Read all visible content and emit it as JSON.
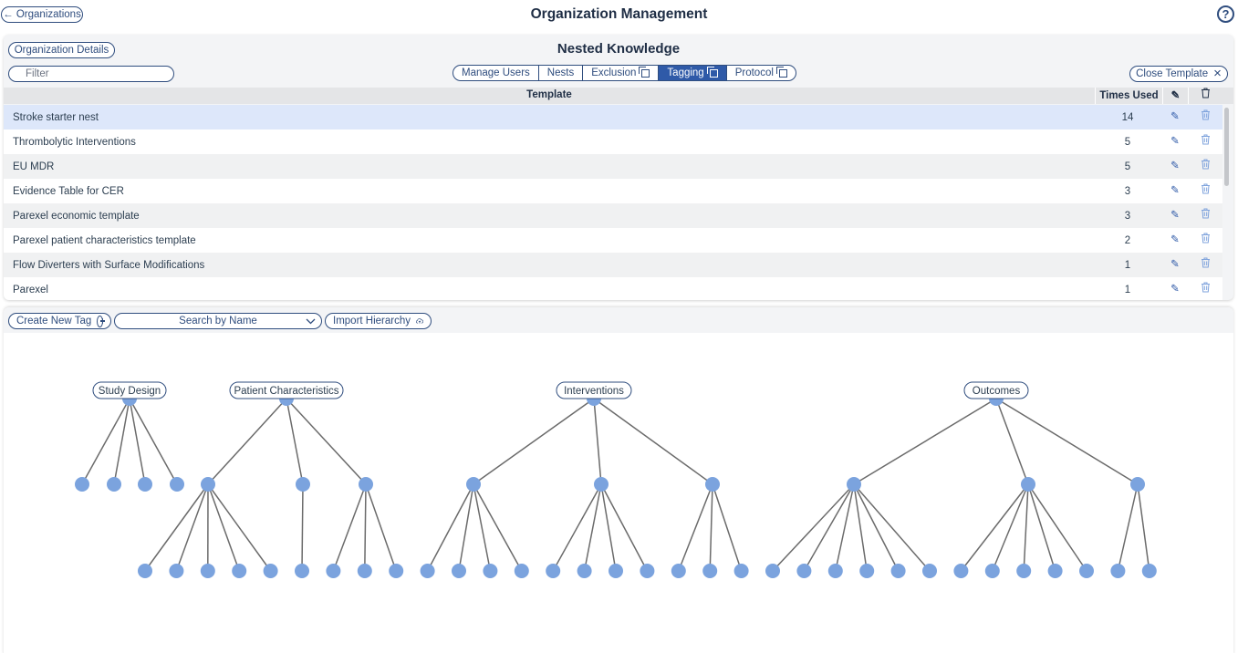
{
  "header": {
    "back_label": "← Organizations",
    "title": "Organization Management",
    "help_label": "?"
  },
  "org": {
    "details_label": "Organization Details",
    "name": "Nested Knowledge",
    "filter_placeholder": "Filter",
    "tabs": [
      {
        "label": "Manage Users",
        "active": false,
        "copy_icon": false
      },
      {
        "label": "Nests",
        "active": false,
        "copy_icon": false
      },
      {
        "label": "Exclusion",
        "active": false,
        "copy_icon": true
      },
      {
        "label": "Tagging",
        "active": true,
        "copy_icon": true
      },
      {
        "label": "Protocol",
        "active": false,
        "copy_icon": true
      }
    ],
    "close_template_label": "Close Template",
    "close_icon": "×"
  },
  "table": {
    "col_template": "Template",
    "col_times": "Times Used",
    "edit_icon": "✎",
    "delete_icon": "🗑",
    "rows": [
      {
        "name": "Stroke starter nest",
        "times": "14",
        "selected": true
      },
      {
        "name": "Thrombolytic Interventions",
        "times": "5",
        "selected": false
      },
      {
        "name": "EU MDR",
        "times": "5",
        "selected": false
      },
      {
        "name": "Evidence Table for CER",
        "times": "3",
        "selected": false
      },
      {
        "name": "Parexel economic template",
        "times": "3",
        "selected": false
      },
      {
        "name": "Parexel patient characteristics template",
        "times": "2",
        "selected": false
      },
      {
        "name": "Flow Diverters with Surface Modifications",
        "times": "1",
        "selected": false
      },
      {
        "name": "Parexel",
        "times": "1",
        "selected": false
      }
    ]
  },
  "tree_toolbar": {
    "create_label": "Create New Tag",
    "search_label": "Search by Name",
    "import_label": "Import Hierarchy"
  },
  "tree": {
    "roots": [
      {
        "label": "Study Design",
        "children": [
          0,
          0,
          0,
          0
        ]
      },
      {
        "label": "Patient Characteristics",
        "children": [
          5,
          1,
          3
        ]
      },
      {
        "label": "Interventions",
        "children": [
          4,
          4,
          3
        ]
      },
      {
        "label": "Outcomes",
        "children": [
          6,
          5,
          2
        ]
      }
    ]
  },
  "colors": {
    "accent": "#2f5aa8",
    "node": "#7ba3de",
    "border": "#2f4d7e",
    "selected_row": "#dde7fa"
  }
}
